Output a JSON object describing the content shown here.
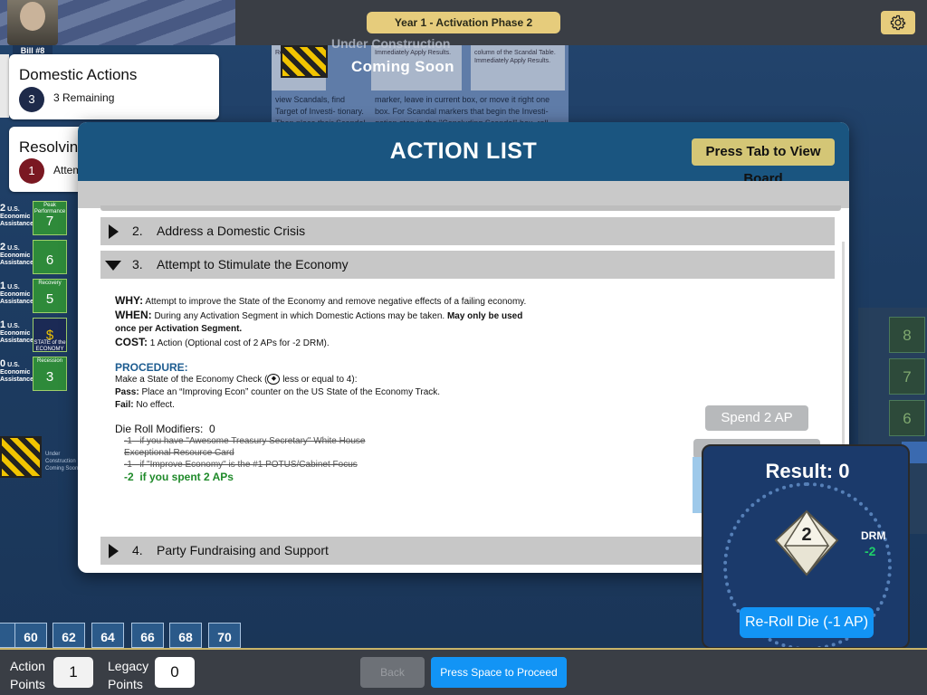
{
  "header": {
    "phase": "Year 1  -  Activation Phase 2",
    "portrait_name": "Bill #8",
    "settings_icon": "gear-icon"
  },
  "board": {
    "under_construction": "Under Construction",
    "coming_soon": "Coming Soon",
    "sign_text": "COMING SOON",
    "text1": "view Scandals, find Target of Investi- tionary. Then place their Scandal \"Breaking Scandal\" box. For the",
    "text2": "marker, leave in current box, or move it right one box. For Scandal markers that begin the Investi- gation step in the \"Concluding Scandal\" box, roll",
    "col_a": "Results.",
    "col_b": "Immediately Apply Results.",
    "col_c": "column of the Scandal Table. Immediately Apply Results.",
    "uc_left_text": "Under Construction Coming Soon",
    "econ_rows": [
      {
        "label_num": "2",
        "label": "U.S. Economic Assistance",
        "box": "7",
        "box_sub": "Peak Performance"
      },
      {
        "label_num": "2",
        "label": "U.S. Economic Assistance",
        "box": "6",
        "box_sub": ""
      },
      {
        "label_num": "1",
        "label": "U.S. Economic Assistance",
        "box": "5",
        "box_sub": "Recovery"
      },
      {
        "label_num": "1",
        "label": "U.S. Economic Assistance",
        "box": "",
        "box_sub": "STATE of the ECONOMY"
      },
      {
        "label_num": "0",
        "label": "U.S. Economic Assistance",
        "box": "3",
        "box_sub": "Recession"
      }
    ],
    "right_nums": [
      "8",
      "7",
      "6"
    ],
    "track": [
      "60",
      "62",
      "64",
      "66",
      "68",
      "70"
    ]
  },
  "domestic": {
    "title": "Domestic Actions",
    "count": "3",
    "remaining": "3 Remaining"
  },
  "resolving": {
    "title": "Resolving",
    "count": "1",
    "sub": "Attem"
  },
  "modal": {
    "title": "ACTION LIST",
    "tab_button": "Press Tab to View Board",
    "items": [
      {
        "num": "2.",
        "label": "Address a Domestic Crisis"
      },
      {
        "num": "3.",
        "label": "Attempt to Stimulate the Economy"
      },
      {
        "num": "4.",
        "label": "Party Fundraising and Support"
      }
    ],
    "why_label": "WHY:",
    "why_text": "Attempt to improve the State of the Economy and remove negative effects of a failing economy.",
    "when_label": "WHEN:",
    "when_text": "During any Activation Segment in which Domestic Actions may be taken.",
    "when_bold": "May only be used once per Activation Segment.",
    "cost_label": "COST:",
    "cost_text": "1 Action (Optional cost of 2 APs for -2 DRM).",
    "procedure_title": "PROCEDURE:",
    "procedure_text_a": "Make a State of the Economy Check (",
    "procedure_text_b": " less or equal to 4):",
    "pass_label": "Pass:",
    "pass_text": "Place an “Improving Econ” counter on the US State of the Economy Track.",
    "fail_label": "Fail:",
    "fail_text": "No effect.",
    "drm_title": "Die Roll Modifiers:",
    "drm_value": "0",
    "mod1_value": "-1",
    "mod1_text": "if you have \"Awesome Treasury Secretary\" White House Exceptional Resource Card",
    "mod2_value": "-1",
    "mod2_text": "if \"Improve Economy\" is the #1 POTUS/Cabinet Focus",
    "mod3_value": "-2",
    "mod3_text": "if you spent 2 APs",
    "spend_button": "Spend 2 AP"
  },
  "result": {
    "title": "Result: 0",
    "die_value": "2",
    "drm_label": "DRM",
    "drm_value": "-2",
    "reroll_button": "Re-Roll Die (-1 AP)"
  },
  "footer": {
    "ap_label": "Action Points",
    "ap_value": "1",
    "lp_label": "Legacy Points",
    "lp_value": "0",
    "back_button": "Back",
    "proceed_button": "Press Space to Proceed"
  },
  "colors": {
    "accent_gold": "#e6cc7c",
    "primary_blue": "#1294f5",
    "header_blue": "#1a5580",
    "positive_green": "#1fd06a"
  }
}
